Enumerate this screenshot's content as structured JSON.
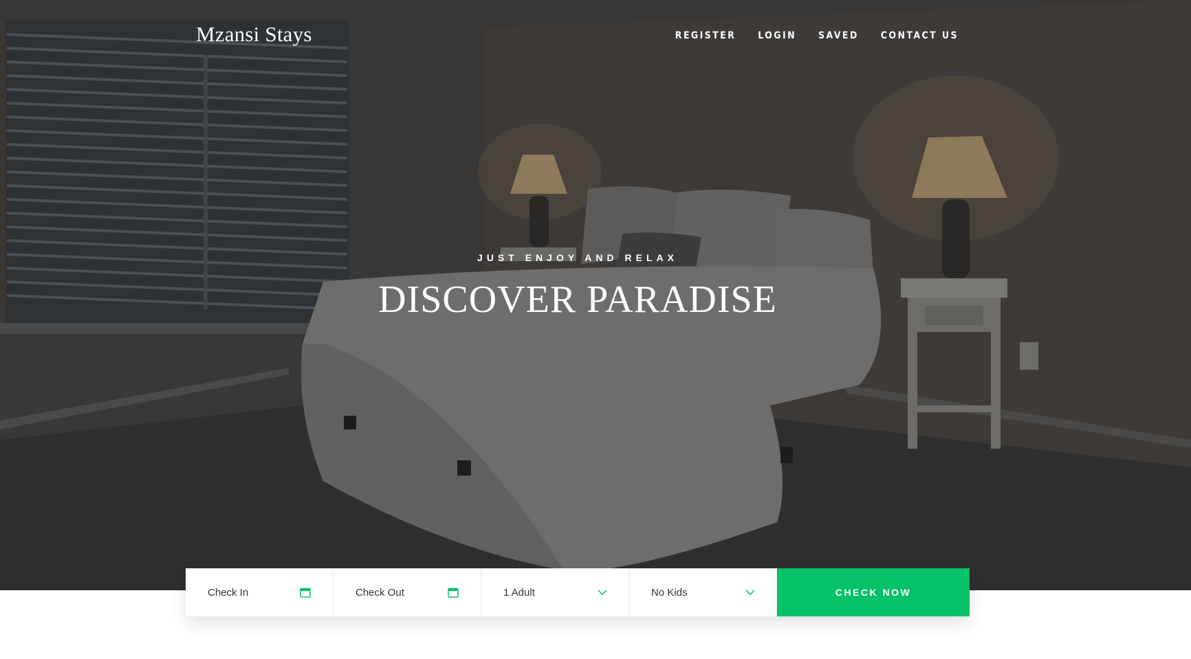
{
  "brand": "Mzansi Stays",
  "nav": [
    {
      "label": "REGISTER"
    },
    {
      "label": "LOGIN"
    },
    {
      "label": "SAVED"
    },
    {
      "label": "CONTACT US"
    }
  ],
  "hero": {
    "tagline": "JUST ENJOY AND RELAX",
    "headline": "DISCOVER PARADISE"
  },
  "booking": {
    "check_in": "Check In",
    "check_out": "Check Out",
    "adults": "1 Adult",
    "kids": "No Kids",
    "submit": "CHECK NOW"
  },
  "colors": {
    "accent": "#06c167",
    "overlay_dark": "#383634",
    "text_light": "#ffffff"
  },
  "icons": [
    "calendar-icon",
    "chevron-down-icon"
  ]
}
